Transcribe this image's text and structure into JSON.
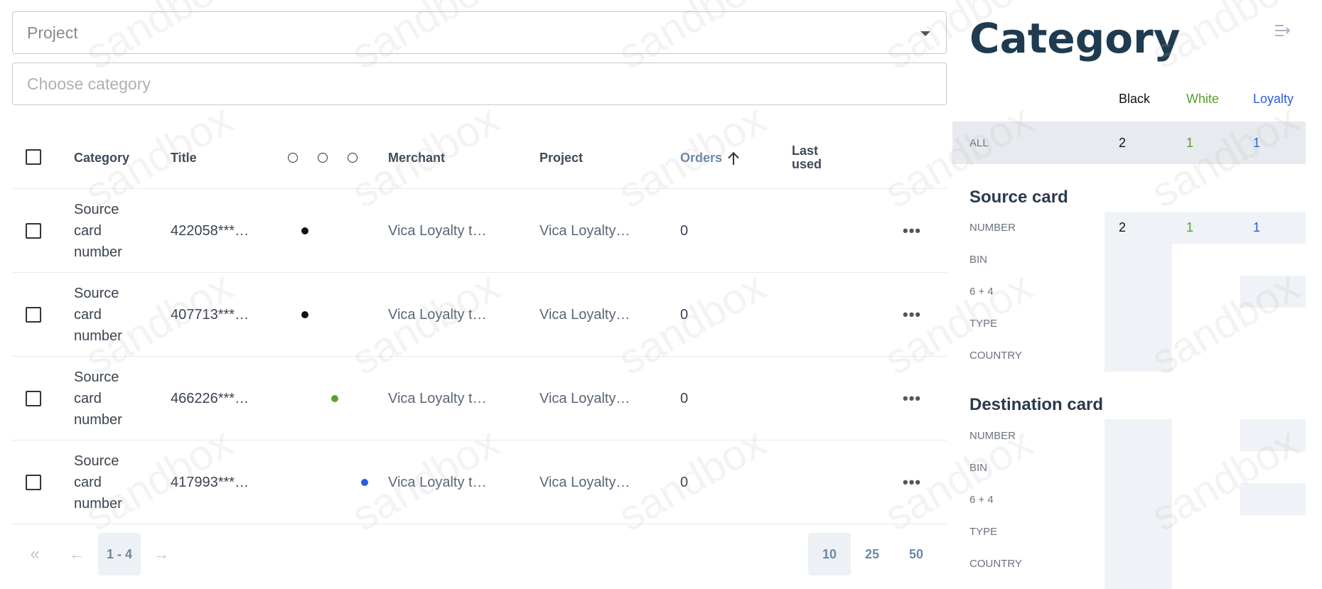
{
  "filters": {
    "project_placeholder": "Project",
    "category_placeholder": "Choose category"
  },
  "table": {
    "headers": {
      "category": "Category",
      "title": "Title",
      "merchant": "Merchant",
      "project": "Project",
      "orders": "Orders",
      "last_used_1": "Last",
      "last_used_2": "used"
    },
    "rows": [
      {
        "cat1": "Source",
        "cat2": "card",
        "cat3": "number",
        "title": "422058***…",
        "dot_color": "#111111",
        "merchant": "Vica Loyalty t…",
        "project": "Vica Loyalty…",
        "orders": "0"
      },
      {
        "cat1": "Source",
        "cat2": "card",
        "cat3": "number",
        "title": "407713***…",
        "dot_color": "#111111",
        "merchant": "Vica Loyalty t…",
        "project": "Vica Loyalty…",
        "orders": "0"
      },
      {
        "cat1": "Source",
        "cat2": "card",
        "cat3": "number",
        "title": "466226***…",
        "dot_color": "#5aa02c",
        "merchant": "Vica Loyalty t…",
        "project": "Vica Loyalty…",
        "orders": "0"
      },
      {
        "cat1": "Source",
        "cat2": "card",
        "cat3": "number",
        "title": "417993***…",
        "dot_color": "#2d5be3",
        "merchant": "Vica Loyalty t…",
        "project": "Vica Loyalty…",
        "orders": "0"
      }
    ]
  },
  "pagination": {
    "first": "«",
    "prev": "←",
    "range": "1 - 4",
    "next": "→",
    "sizes": [
      "10",
      "25",
      "50"
    ]
  },
  "panel": {
    "title": "Category",
    "columns": {
      "black": "Black",
      "white": "White",
      "loyalty": "Loyalty"
    },
    "all": {
      "label": "ALL",
      "black": "2",
      "white": "1",
      "loyalty": "1"
    },
    "source": {
      "title": "Source card",
      "rows": [
        "NUMBER",
        "BIN",
        "6 + 4",
        "TYPE",
        "COUNTRY"
      ],
      "number": {
        "black": "2",
        "white": "1",
        "loyalty": "1"
      }
    },
    "destination": {
      "title": "Destination card",
      "rows": [
        "NUMBER",
        "BIN",
        "6 + 4",
        "TYPE",
        "COUNTRY"
      ]
    },
    "colors": {
      "black": "#111111",
      "white": "#5aa02c",
      "loyalty": "#2d5be3"
    }
  },
  "watermark": "sandbox"
}
